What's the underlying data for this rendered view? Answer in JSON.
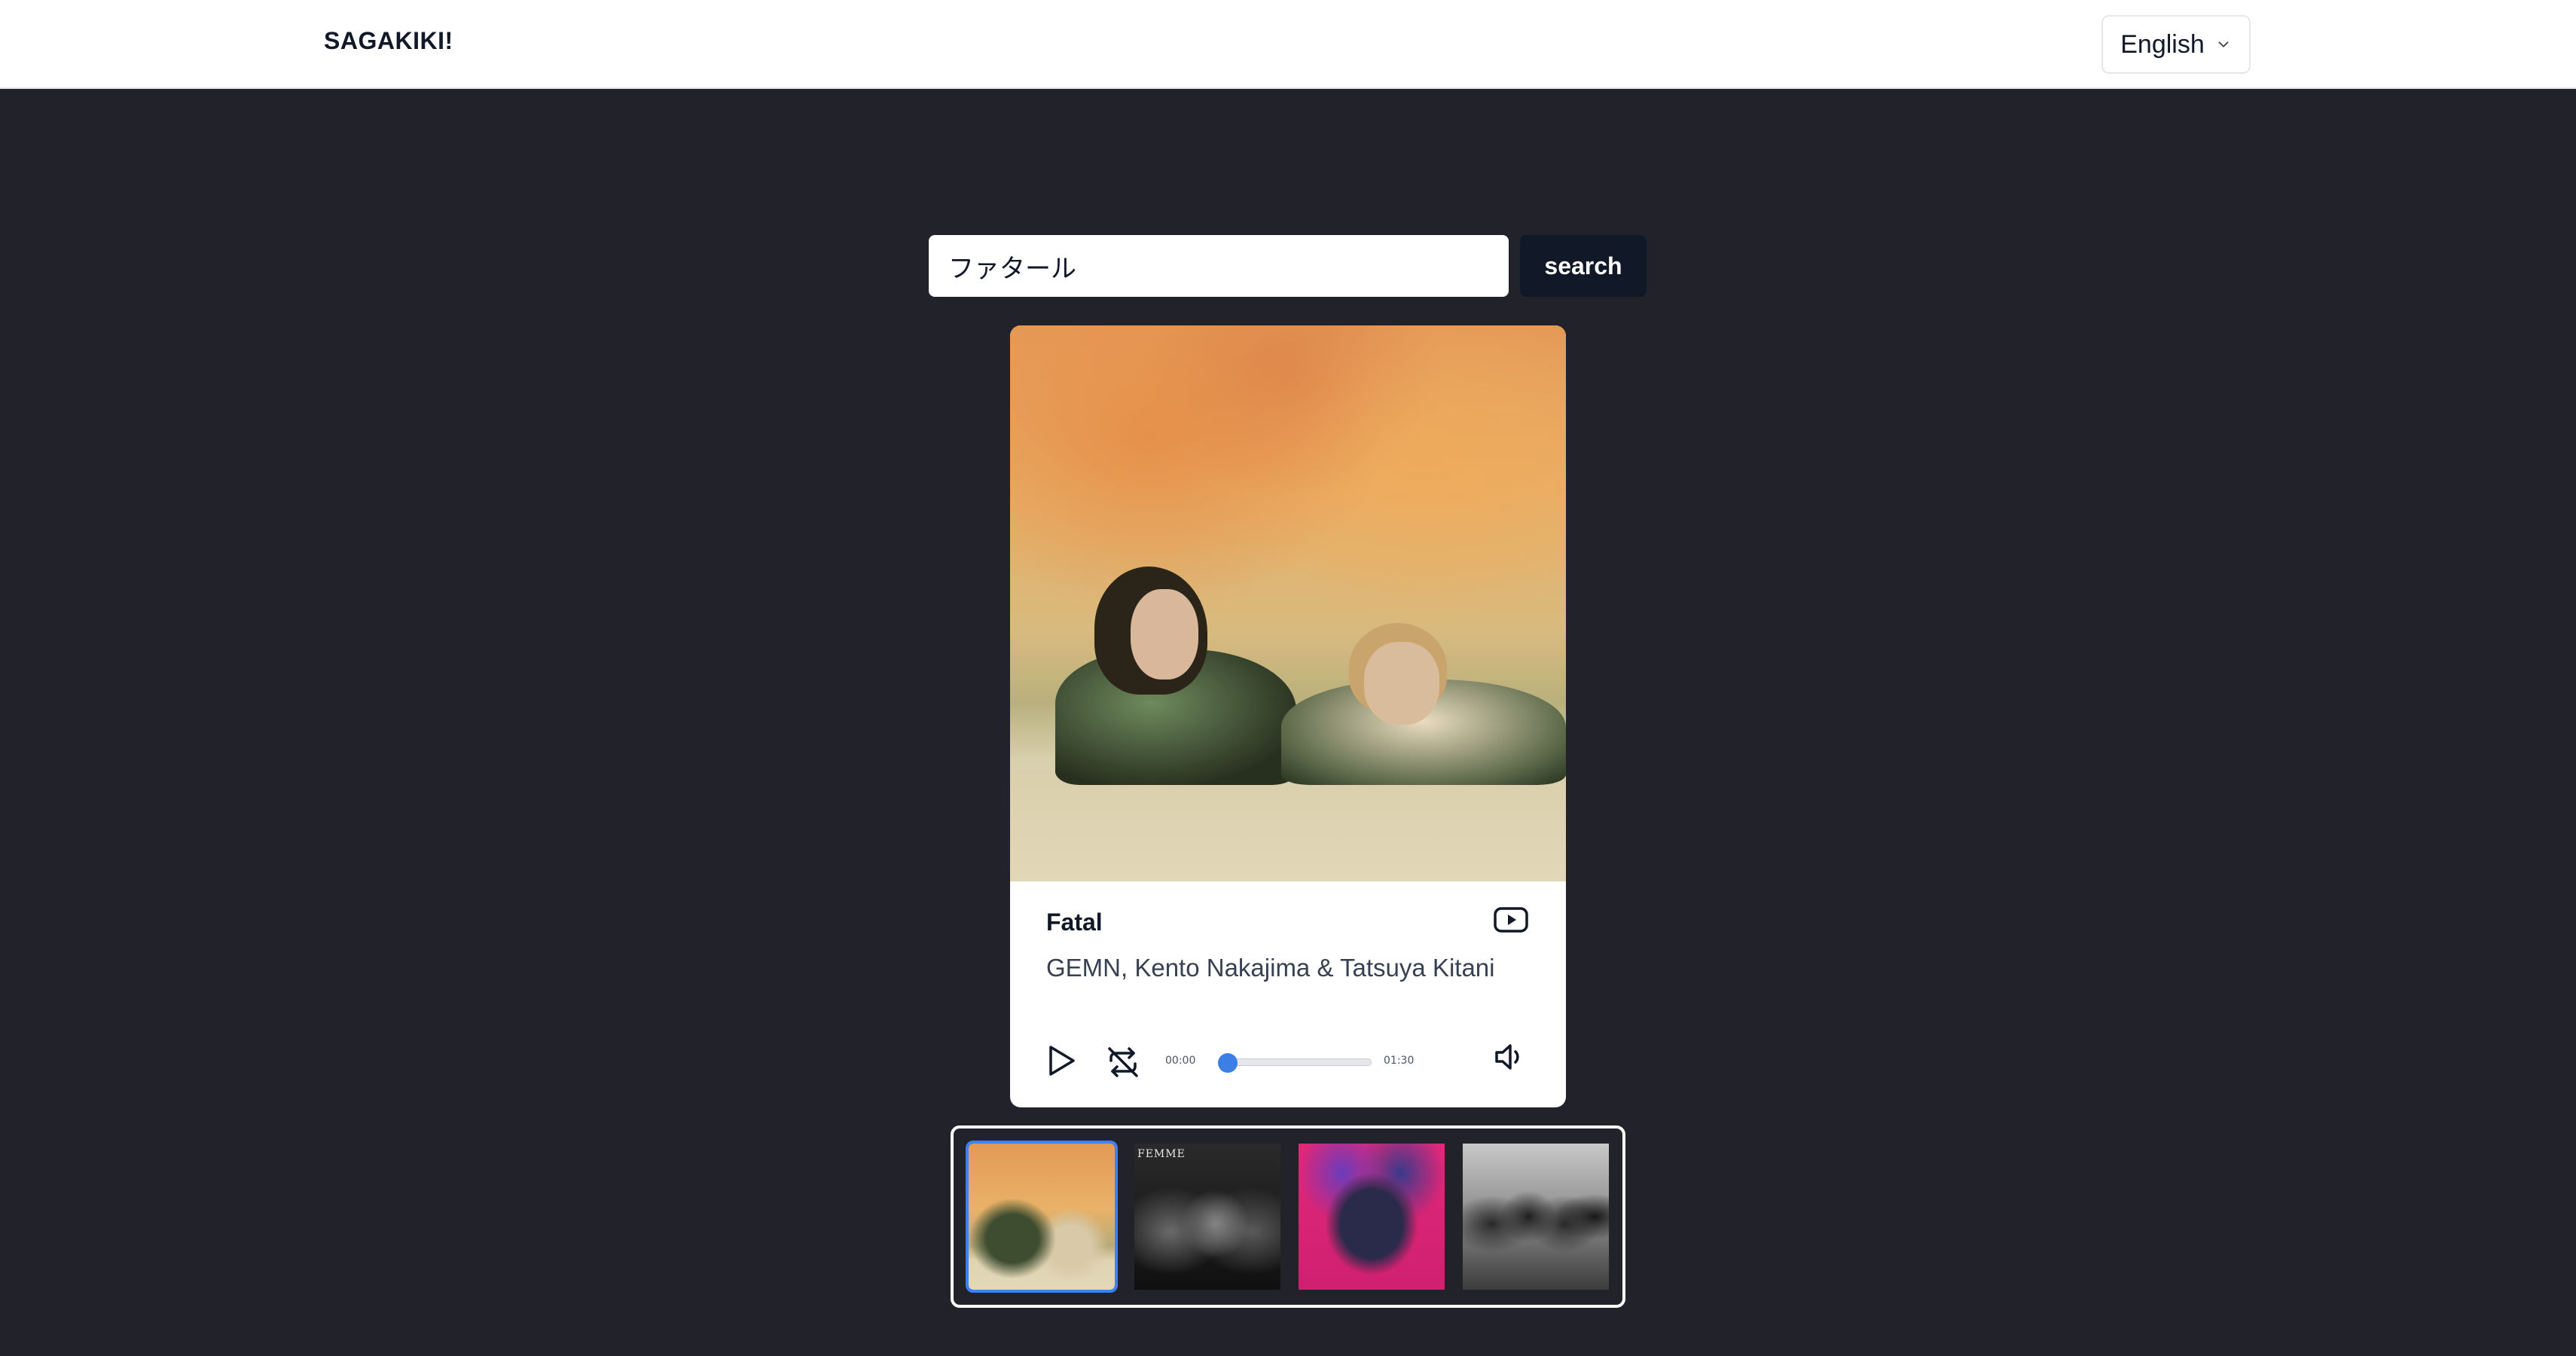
{
  "header": {
    "brand": "SAGAKIKI!",
    "language": {
      "selected": "English",
      "icon": "chevron-down-icon"
    }
  },
  "search": {
    "value": "ファタール",
    "button_label": "search",
    "icon_color": "#111827"
  },
  "player": {
    "title": "Fatal",
    "artist": "GEMN, Kento Nakajima & Tatsuya Kitani",
    "current_time": "00:00",
    "duration": "01:30",
    "progress_fraction": 0,
    "accent_color": "#3b82f6",
    "icons": [
      "youtube-icon",
      "play-icon",
      "repeat-off-icon",
      "volume-icon"
    ]
  },
  "carousel": {
    "selected_index": 0,
    "items": [
      {
        "name": "album-cover-1"
      },
      {
        "name": "album-cover-2",
        "label": "FEMME"
      },
      {
        "name": "album-cover-3"
      },
      {
        "name": "album-cover-4"
      }
    ]
  }
}
